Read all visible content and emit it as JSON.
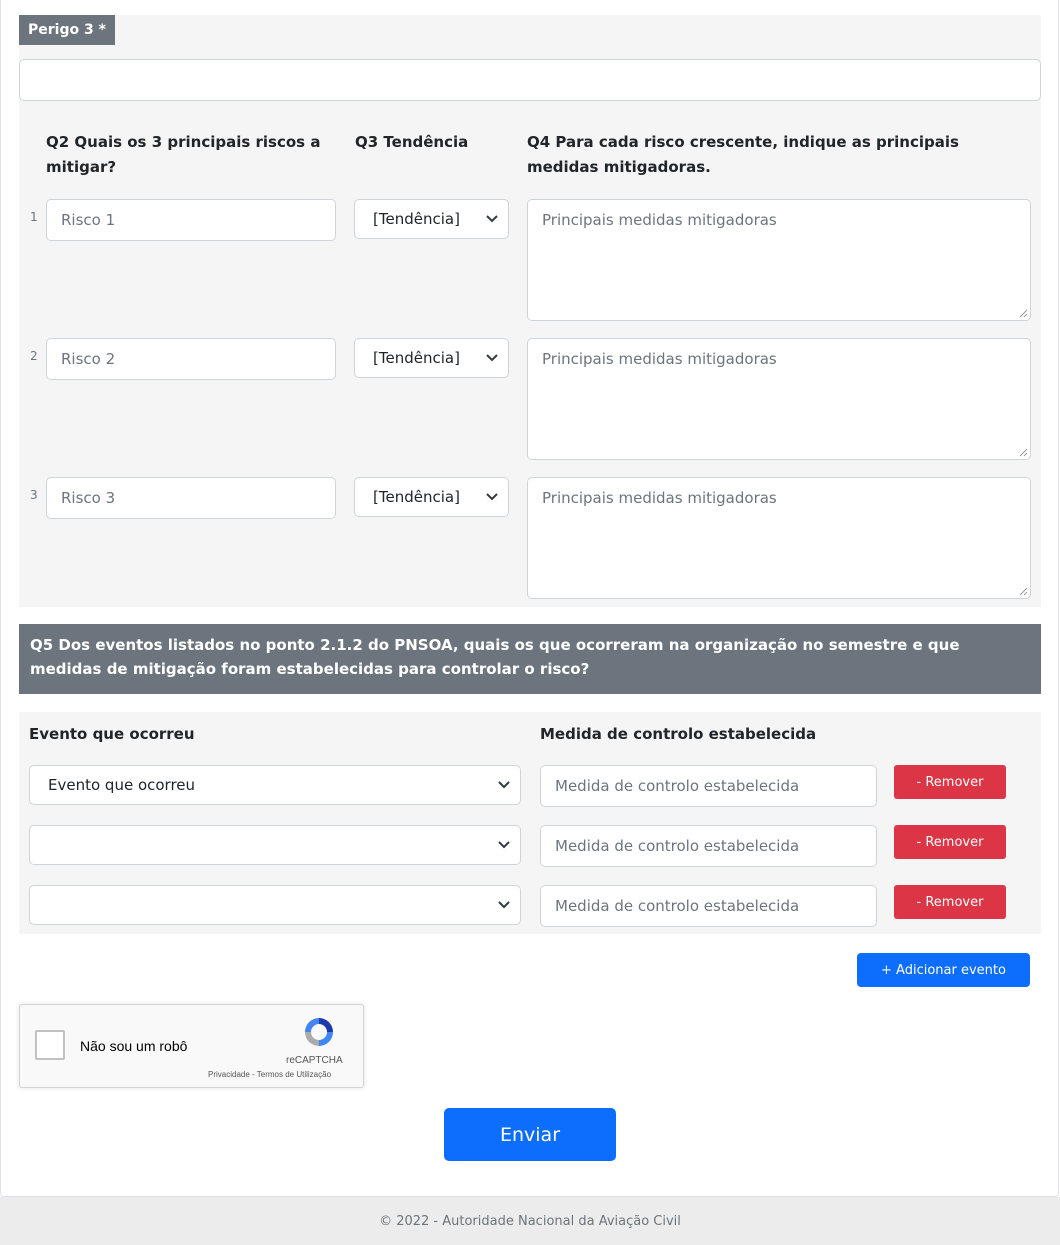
{
  "perigo": {
    "badge": "Perigo 3 *",
    "input_value": ""
  },
  "risks": {
    "headers": {
      "q2": "Q2 Quais os 3 principais riscos a mitigar?",
      "q3": "Q3 Tendência",
      "q4": "Q4 Para cada risco crescente, indique as principais medidas mitigadoras."
    },
    "rows": [
      {
        "num": "1",
        "risk_placeholder": "Risco 1",
        "trend": "[Tendência]",
        "mitigation_placeholder": "Principais medidas mitigadoras"
      },
      {
        "num": "2",
        "risk_placeholder": "Risco 2",
        "trend": "[Tendência]",
        "mitigation_placeholder": "Principais medidas mitigadoras"
      },
      {
        "num": "3",
        "risk_placeholder": "Risco 3",
        "trend": "[Tendência]",
        "mitigation_placeholder": "Principais medidas mitigadoras"
      }
    ]
  },
  "q5": {
    "title": "Q5 Dos eventos listados no ponto 2.1.2 do PNSOA, quais os que ocorreram na organização no semestre e que medidas de mitigação foram estabelecidas para controlar o risco?",
    "col_event": "Evento que ocorreu",
    "col_measure": "Medida de controlo estabelecida",
    "rows": [
      {
        "event": "Evento que ocorreu",
        "measure_placeholder": "Medida de controlo estabelecida",
        "remove_label": "- Remover"
      },
      {
        "event": "",
        "measure_placeholder": "Medida de controlo estabelecida",
        "remove_label": "- Remover"
      },
      {
        "event": "",
        "measure_placeholder": "Medida de controlo estabelecida",
        "remove_label": "- Remover"
      }
    ],
    "add_label": "+ Adicionar evento"
  },
  "recaptcha": {
    "label": "Não sou um robô",
    "brand": "reCAPTCHA",
    "links": "Privacidade - Termos de Utilização"
  },
  "submit_label": "Enviar",
  "footer": "© 2022 - Autoridade Nacional da Aviação Civil",
  "colors": {
    "primary": "#0d6efd",
    "danger": "#dc3545",
    "secondary": "#6c757d"
  }
}
